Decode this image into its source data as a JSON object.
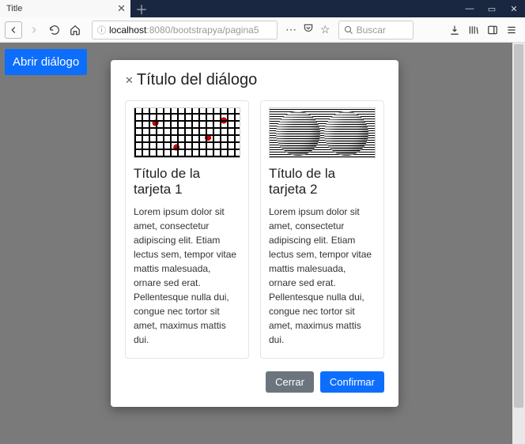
{
  "browser": {
    "tab_title": "Title",
    "url": {
      "host": "localhost",
      "port": ":8080",
      "path": "/bootstrapya/pagina5"
    },
    "search_placeholder": "Buscar"
  },
  "page": {
    "open_button": "Abrir diálogo"
  },
  "dialog": {
    "title": "Título del diálogo",
    "cards": [
      {
        "title": "Título de la tarjeta 1",
        "text": "Lorem ipsum dolor sit amet, consectetur adipiscing elit. Etiam lectus sem, tempor vitae mattis malesuada, ornare sed erat. Pellentesque nulla dui, congue nec tortor sit amet, maximus mattis dui."
      },
      {
        "title": "Título de la tarjeta 2",
        "text": "Lorem ipsum dolor sit amet, consectetur adipiscing elit. Etiam lectus sem, tempor vitae mattis malesuada, ornare sed erat. Pellentesque nulla dui, congue nec tortor sit amet, maximus mattis dui."
      }
    ],
    "footer": {
      "close": "Cerrar",
      "confirm": "Confirmar"
    }
  }
}
